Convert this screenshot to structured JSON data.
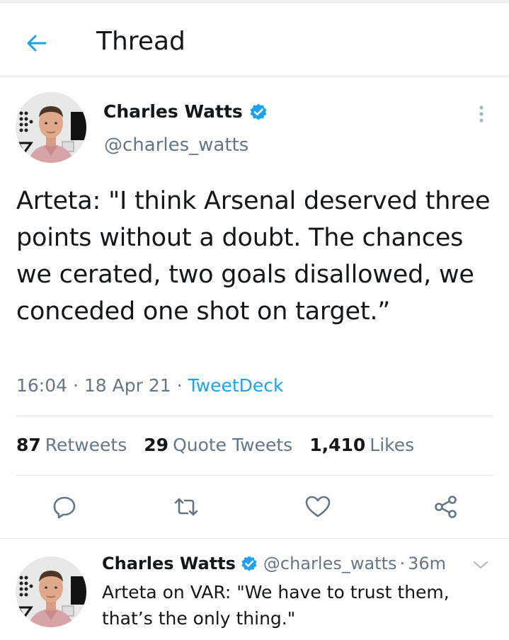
{
  "header": {
    "title": "Thread",
    "back_icon": "arrow-left-icon",
    "accent": "#1da1f2"
  },
  "tweet": {
    "author": {
      "display_name": "Charles Watts",
      "handle": "@charles_watts",
      "verified": true,
      "avatar_icon": "profile-photo"
    },
    "text": "Arteta: \"I think Arsenal deserved three points without a doubt. The chances we cerated, two goals disallowed, we conceded one shot on target.”",
    "time": "16:04",
    "sep1": " · ",
    "date": "18 Apr 21",
    "sep2": " · ",
    "source": "TweetDeck",
    "stats": {
      "retweets_count": "87",
      "retweets_label": "Retweets",
      "quotes_count": "29",
      "quotes_label": "Quote Tweets",
      "likes_count": "1,410",
      "likes_label": "Likes"
    },
    "actions": [
      "reply-icon",
      "retweet-icon",
      "like-icon",
      "share-icon"
    ]
  },
  "reply": {
    "display_name": "Charles Watts",
    "handle": "@charles_watts",
    "dot": "·",
    "time": "36m",
    "verified": true,
    "text": "Arteta on VAR: \"We have to trust them, that’s the only thing.\""
  },
  "colors": {
    "text_primary": "#14171a",
    "text_secondary": "#657786",
    "link": "#1da1f2",
    "divider": "#e1e8ed",
    "verified_badge": "#1da1f2"
  }
}
